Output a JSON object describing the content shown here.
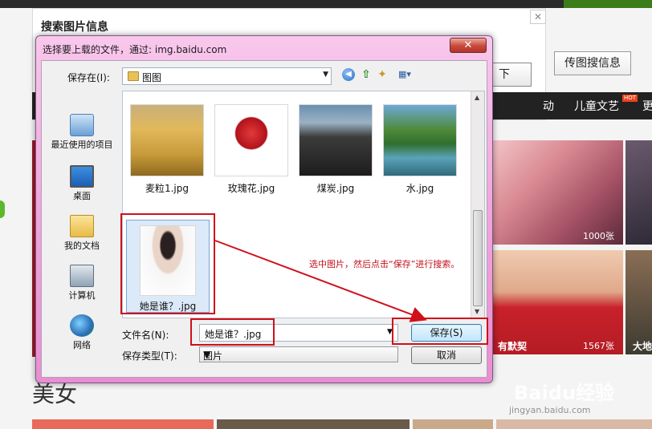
{
  "background": {
    "panel_title": "搜索图片信息",
    "panel_close": "✕",
    "next_button": "下",
    "upload_button": "传图搜信息",
    "nav_items": [
      "动",
      "儿童文艺",
      "更"
    ],
    "nav_badge": "HOT",
    "photo_counts": [
      "1000张",
      "1567张"
    ],
    "photo_tags": [
      "有默契",
      "大地"
    ],
    "section_title": "美女",
    "watermark": "Baidu经验",
    "watermark_sub": "jingyan.baidu.com"
  },
  "dialog": {
    "title": "选择要上载的文件，通过: img.baidu.com",
    "close_label": "✕",
    "look_in": {
      "label": "保存在(I):",
      "value": "图图"
    },
    "toolbar_icons": [
      "back-icon",
      "up-folder-icon",
      "new-folder-icon",
      "view-menu-icon"
    ],
    "places": [
      {
        "label": "最近使用的项目",
        "icon": "recent-items-icon"
      },
      {
        "label": "桌面",
        "icon": "desktop-icon"
      },
      {
        "label": "我的文档",
        "icon": "my-documents-icon"
      },
      {
        "label": "计算机",
        "icon": "computer-icon"
      },
      {
        "label": "网络",
        "icon": "network-icon"
      }
    ],
    "files": [
      {
        "name": "麦粒1.jpg"
      },
      {
        "name": "玫瑰花.jpg"
      },
      {
        "name": "煤炭.jpg"
      },
      {
        "name": "水.jpg"
      },
      {
        "name": "她是谁？.jpg",
        "selected": true
      }
    ],
    "instruction": "选中图片，然后点击“保存”进行搜索。",
    "filename": {
      "label": "文件名(N):",
      "value": "她是谁？.jpg"
    },
    "filetype": {
      "label": "保存类型(T):",
      "value": "图片"
    },
    "save_label": "保存(S)",
    "cancel_label": "取消"
  },
  "colors": {
    "annotation_red": "#d0101a",
    "dialog_chrome": "#f0a6dc",
    "nav_bg": "#222222"
  }
}
